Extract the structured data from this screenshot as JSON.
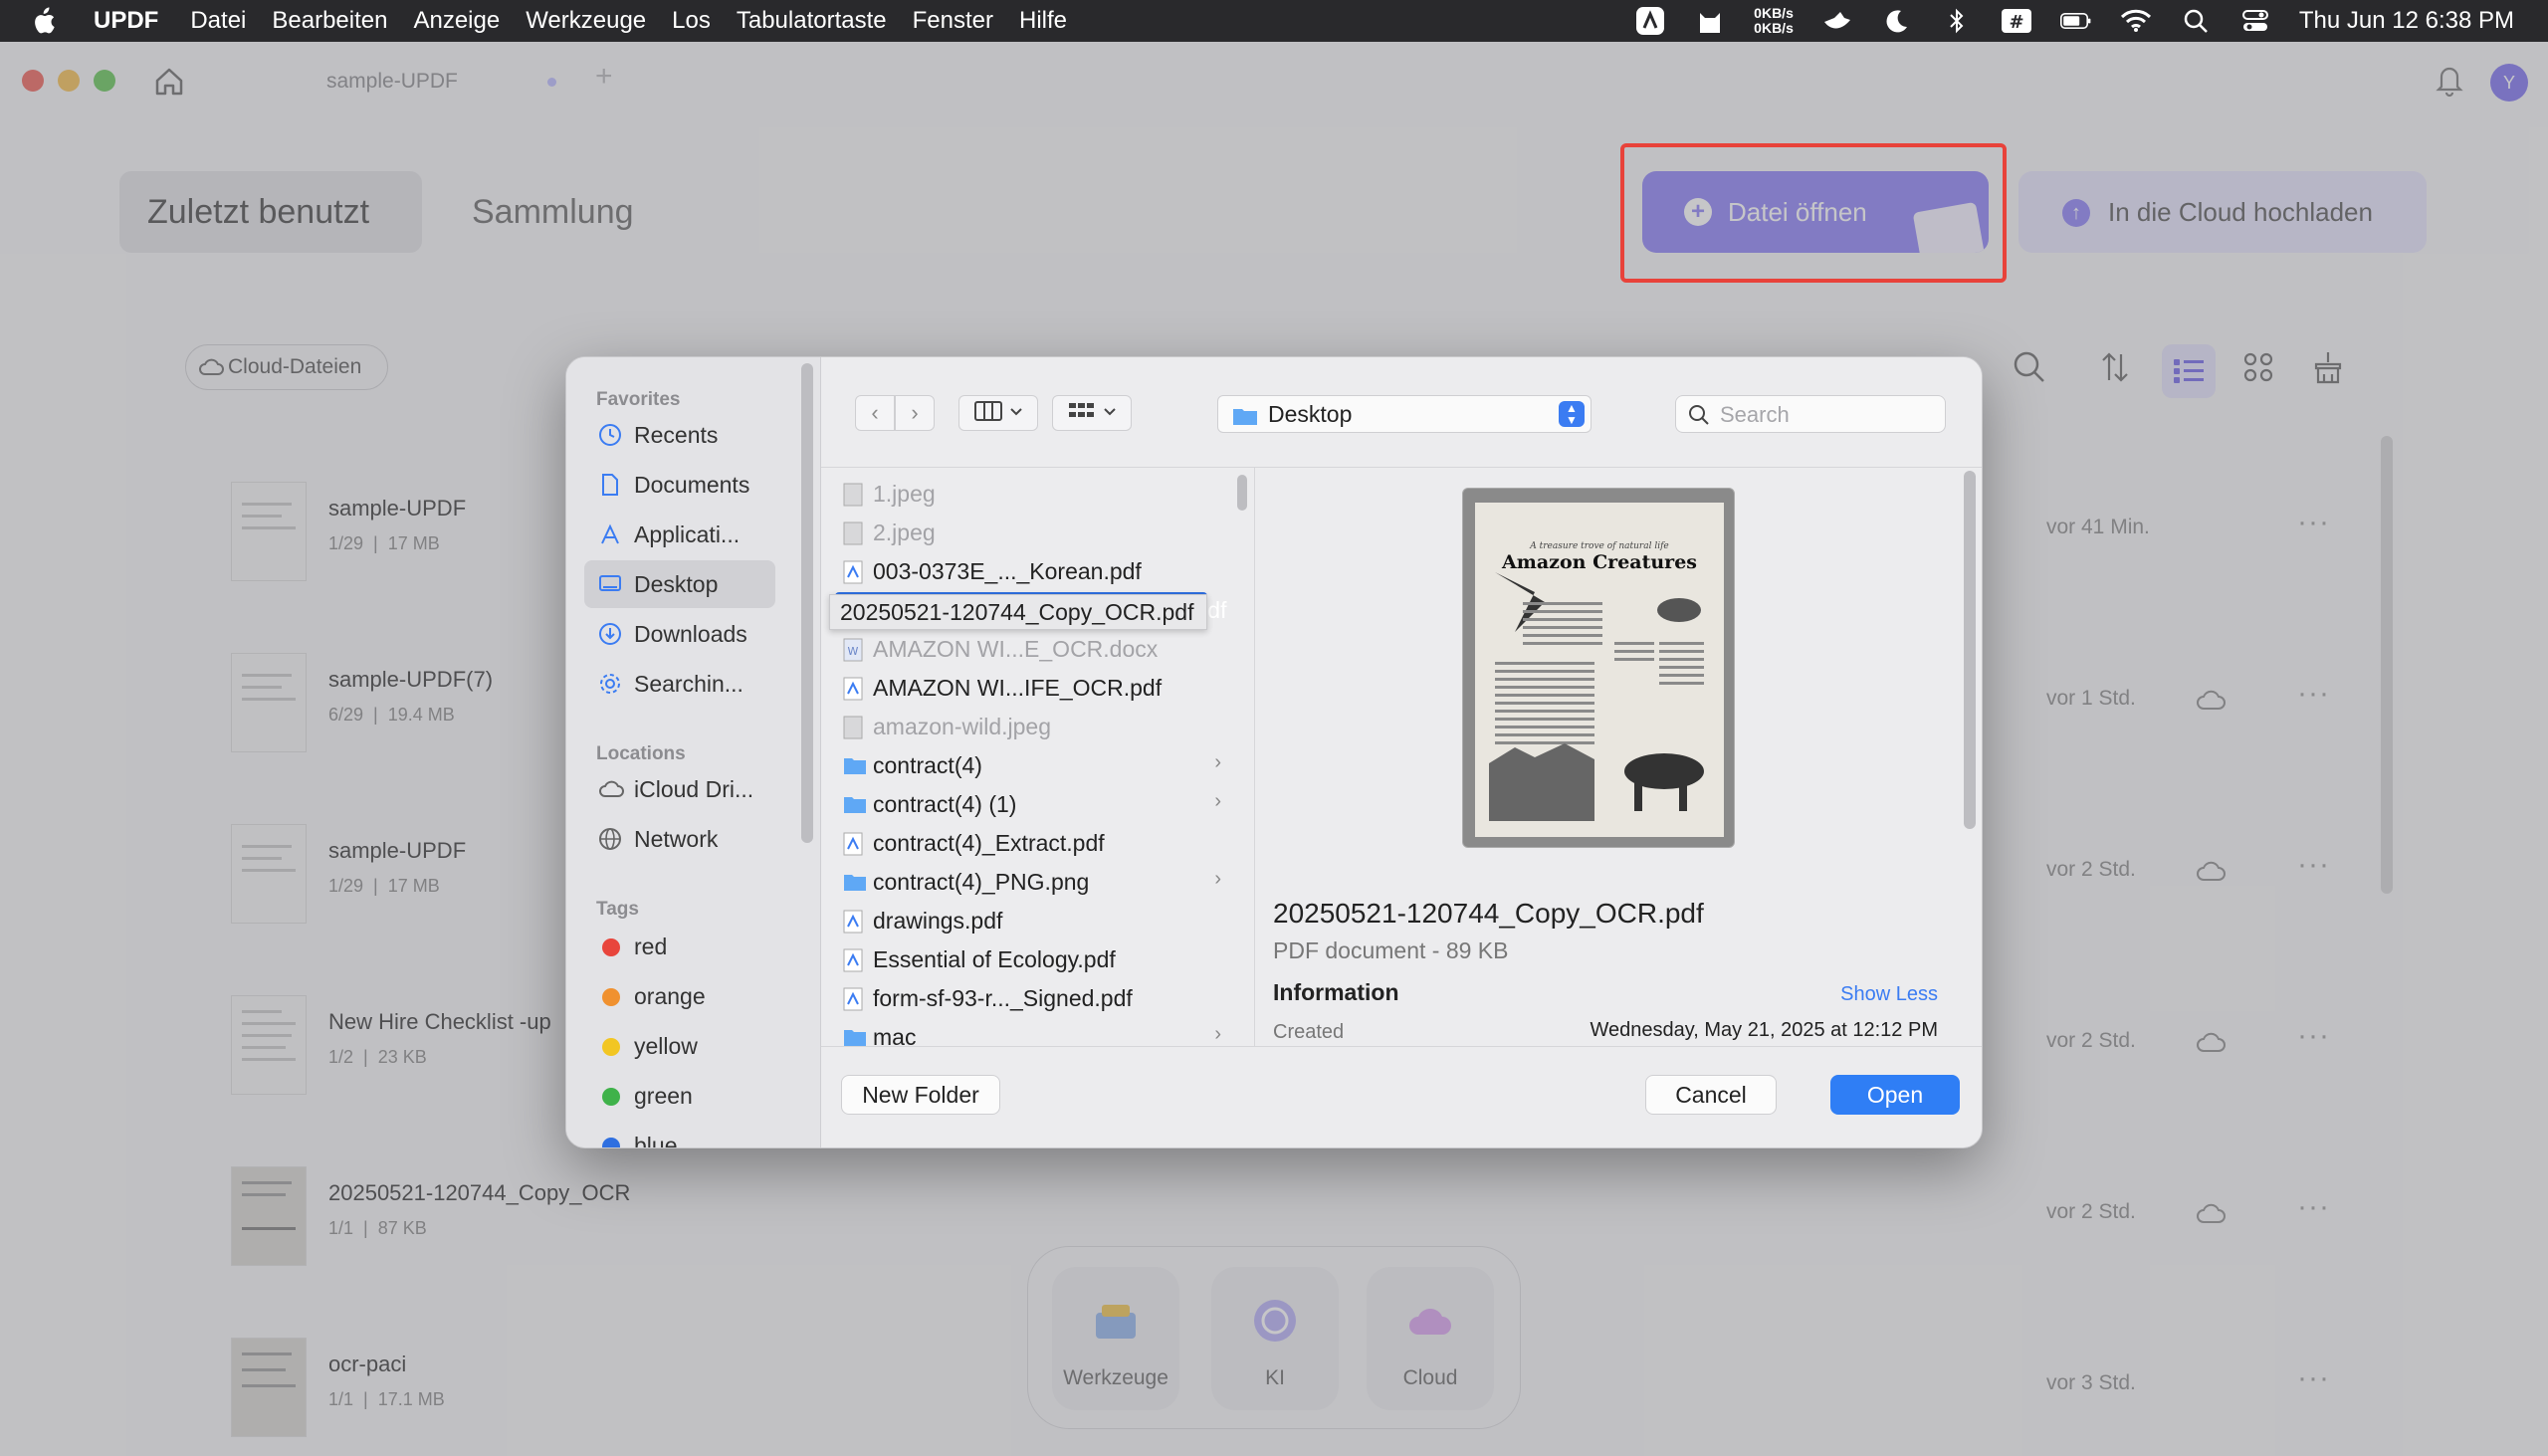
{
  "menubar": {
    "app": "UPDF",
    "items": [
      "Datei",
      "Bearbeiten",
      "Anzeige",
      "Werkzeuge",
      "Los",
      "Tabulatortaste",
      "Fenster",
      "Hilfe"
    ],
    "net_up": "0KB/s",
    "net_down": "0KB/s",
    "clock": "Thu Jun 12  6:38 PM"
  },
  "window": {
    "tab_title": "sample-UPDF",
    "avatar_letter": "Y",
    "segments": [
      "Zuletzt benutzt",
      "Sammlung"
    ],
    "open_button": "Datei öffnen",
    "cloud_upload_button": "In die Cloud hochladen",
    "cloud_files_chip": "Cloud-Dateien"
  },
  "recent_files": [
    {
      "name": "sample-UPDF",
      "pages": "1/29",
      "size": "17 MB",
      "time": "vor 41 Min.",
      "cloud": false
    },
    {
      "name": "sample-UPDF(7)",
      "pages": "6/29",
      "size": "19.4 MB",
      "time": "vor 1 Std.",
      "cloud": true
    },
    {
      "name": "sample-UPDF",
      "pages": "1/29",
      "size": "17 MB",
      "time": "vor 2 Std.",
      "cloud": true
    },
    {
      "name": "New Hire Checklist -up",
      "pages": "1/2",
      "size": "23 KB",
      "time": "vor 2 Std.",
      "cloud": true
    },
    {
      "name": "20250521-120744_Copy_OCR",
      "pages": "1/1",
      "size": "87 KB",
      "time": "vor 2 Std.",
      "cloud": true
    },
    {
      "name": "ocr-paci",
      "pages": "1/1",
      "size": "17.1 MB",
      "time": "vor 3 Std.",
      "cloud": false
    }
  ],
  "dock": {
    "items": [
      "Werkzeuge",
      "KI",
      "Cloud"
    ]
  },
  "dialog": {
    "sidebar": {
      "favorites_heading": "Favorites",
      "favorites": [
        "Recents",
        "Documents",
        "Applicati...",
        "Desktop",
        "Downloads",
        "Searchin..."
      ],
      "locations_heading": "Locations",
      "locations": [
        "iCloud Dri...",
        "Network"
      ],
      "tags_heading": "Tags",
      "tags": [
        {
          "name": "red",
          "color": "#e8453c"
        },
        {
          "name": "orange",
          "color": "#f0912f"
        },
        {
          "name": "yellow",
          "color": "#f2c623"
        },
        {
          "name": "green",
          "color": "#3fb24a"
        },
        {
          "name": "blue",
          "color": "#2f6fe0"
        }
      ]
    },
    "location": "Desktop",
    "search_placeholder": "Search",
    "files": [
      {
        "name": "1.jpeg",
        "kind": "image",
        "enabled": false
      },
      {
        "name": "2.jpeg",
        "kind": "image",
        "enabled": false
      },
      {
        "name": "003-0373E_..._Korean.pdf",
        "kind": "pdf",
        "enabled": true
      },
      {
        "name": "20250521-120744_Copy_OCR.pdf",
        "kind": "pdf",
        "enabled": true,
        "selected": true
      },
      {
        "name": "AMAZON WI...E_OCR.docx",
        "kind": "docx",
        "enabled": false
      },
      {
        "name": "AMAZON WI...IFE_OCR.pdf",
        "kind": "pdf",
        "enabled": true
      },
      {
        "name": "amazon-wild.jpeg",
        "kind": "image",
        "enabled": false
      },
      {
        "name": "contract(4)",
        "kind": "folder",
        "enabled": true
      },
      {
        "name": "contract(4) (1)",
        "kind": "folder",
        "enabled": true
      },
      {
        "name": "contract(4)_Extract.pdf",
        "kind": "pdf",
        "enabled": true
      },
      {
        "name": "contract(4)_PNG.png",
        "kind": "folder",
        "enabled": true
      },
      {
        "name": "drawings.pdf",
        "kind": "pdf",
        "enabled": true
      },
      {
        "name": "Essential of Ecology.pdf",
        "kind": "pdf",
        "enabled": true
      },
      {
        "name": "form-sf-93-r..._Signed.pdf",
        "kind": "pdf",
        "enabled": true
      },
      {
        "name": "mac",
        "kind": "folder",
        "enabled": true
      }
    ],
    "preview": {
      "doc_heading_small": "A treasure trove of natural life",
      "doc_heading": "Amazon Creatures",
      "name": "20250521-120744_Copy_OCR.pdf",
      "type": "PDF document - 89 KB",
      "info_heading": "Information",
      "show_less": "Show Less",
      "created_label": "Created",
      "created_value": "Wednesday, May 21, 2025 at 12:12 PM"
    },
    "new_folder": "New Folder",
    "cancel": "Cancel",
    "open": "Open"
  }
}
